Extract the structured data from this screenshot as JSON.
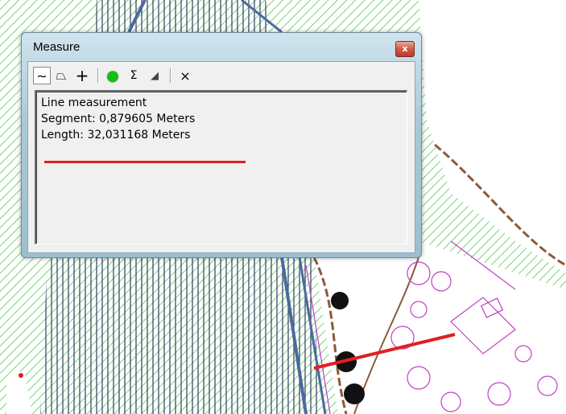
{
  "window": {
    "title": "Measure",
    "close_glyph": "x"
  },
  "toolbar": {
    "tools": [
      {
        "name": "measure-line-tool",
        "glyph": "∼",
        "active": true
      },
      {
        "name": "measure-area-tool",
        "glyph": "⏢"
      },
      {
        "name": "measure-feature-tool",
        "glyph": "+"
      },
      {
        "name": "snapping-toggle",
        "glyph": "●"
      },
      {
        "name": "sum-tool",
        "glyph": "Σ"
      },
      {
        "name": "units-tool",
        "glyph": "◢"
      },
      {
        "name": "clear-tool",
        "glyph": "×"
      }
    ]
  },
  "output": {
    "line1": "Line measurement",
    "line2": "Segment: 0,879605 Meters",
    "line3": "Length: 32,031168 Meters"
  },
  "colors": {
    "hatch_green": "#78d478",
    "road_blue": "#4a6a9c",
    "magenta": "#c040c0",
    "brown": "#8b5a3a",
    "measure_red": "#e21f1f",
    "snap_green": "#11c211"
  }
}
